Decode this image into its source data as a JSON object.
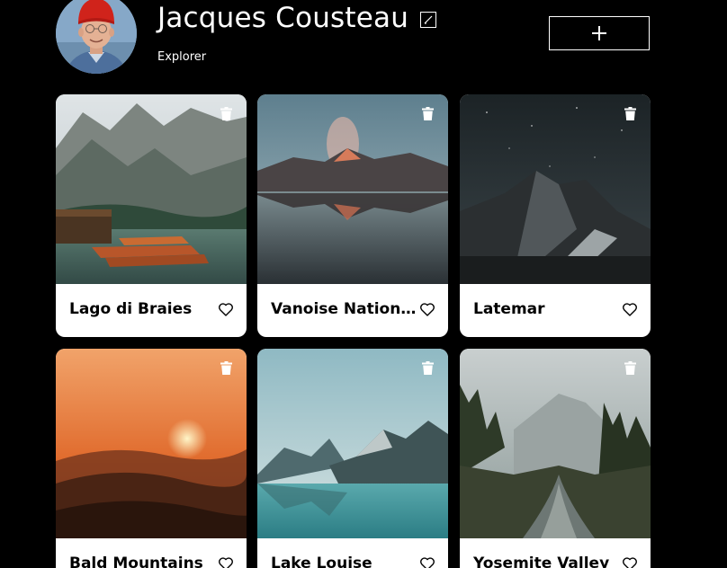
{
  "profile": {
    "name": "Jacques Cousteau",
    "about": "Explorer",
    "avatar_icon": "profile-photo",
    "edit_icon": "pencil-icon",
    "add_icon": "plus-icon"
  },
  "cards": [
    {
      "title": "Lago di Braies",
      "liked": false
    },
    {
      "title": "Vanoise National Park",
      "liked": false
    },
    {
      "title": "Latemar",
      "liked": false
    },
    {
      "title": "Bald Mountains",
      "liked": false
    },
    {
      "title": "Lake Louise",
      "liked": false
    },
    {
      "title": "Yosemite Valley",
      "liked": false
    }
  ],
  "colors": {
    "background": "#000000",
    "card_background": "#ffffff",
    "text_primary": "#ffffff",
    "card_text": "#000000"
  }
}
